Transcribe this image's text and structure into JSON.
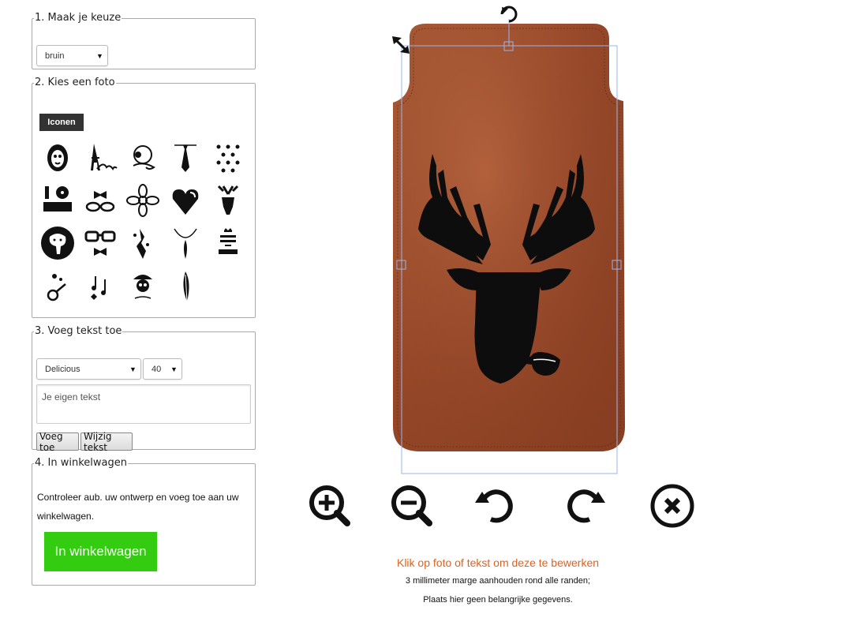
{
  "step1": {
    "legend": "1. Maak je keuze",
    "color_select": "bruin"
  },
  "step2": {
    "legend": "2. Kies een foto",
    "tab_label": "Iconen",
    "icons": [
      "lion-face-icon",
      "eiffel-tower-amour-icon",
      "headphones-icon",
      "necktie-icon",
      "mustache-pattern-icon",
      "i-love-you-icon",
      "bow-tie-glasses-icon",
      "flower-icon",
      "heart-icon",
      "deer-head-icon",
      "elephant-icon",
      "glasses-bowtie-icon",
      "bird-splash-icon",
      "necklace-feather-icon",
      "keep-calm-king-icon",
      "horn-music-icon",
      "music-notes-icon",
      "skull-hat-icon",
      "feather-icon"
    ]
  },
  "step3": {
    "legend": "3. Voeg tekst toe",
    "font_select": "Delicious",
    "size_select": "40",
    "text_placeholder": "Je eigen tekst",
    "add_label": "Voeg toe",
    "edit_label": "Wijzig tekst"
  },
  "step4": {
    "legend": "4. In winkelwagen",
    "description": "Controleer aub. uw ontwerp en voeg toe aan uw winkelwagen.",
    "cart_button": "In winkelwagen",
    "cart_color": "#33cc11"
  },
  "canvas": {
    "case_color": "#a0502e",
    "tools": [
      "zoom-in-icon",
      "zoom-out-icon",
      "rotate-left-icon",
      "rotate-right-icon",
      "delete-icon"
    ],
    "hint_primary": "Klik op foto of tekst om deze te bewerken",
    "hint_line1": "3 millimeter marge aanhouden rond alle randen;",
    "hint_line2": "Plaats hier geen belangrijke gegevens."
  }
}
